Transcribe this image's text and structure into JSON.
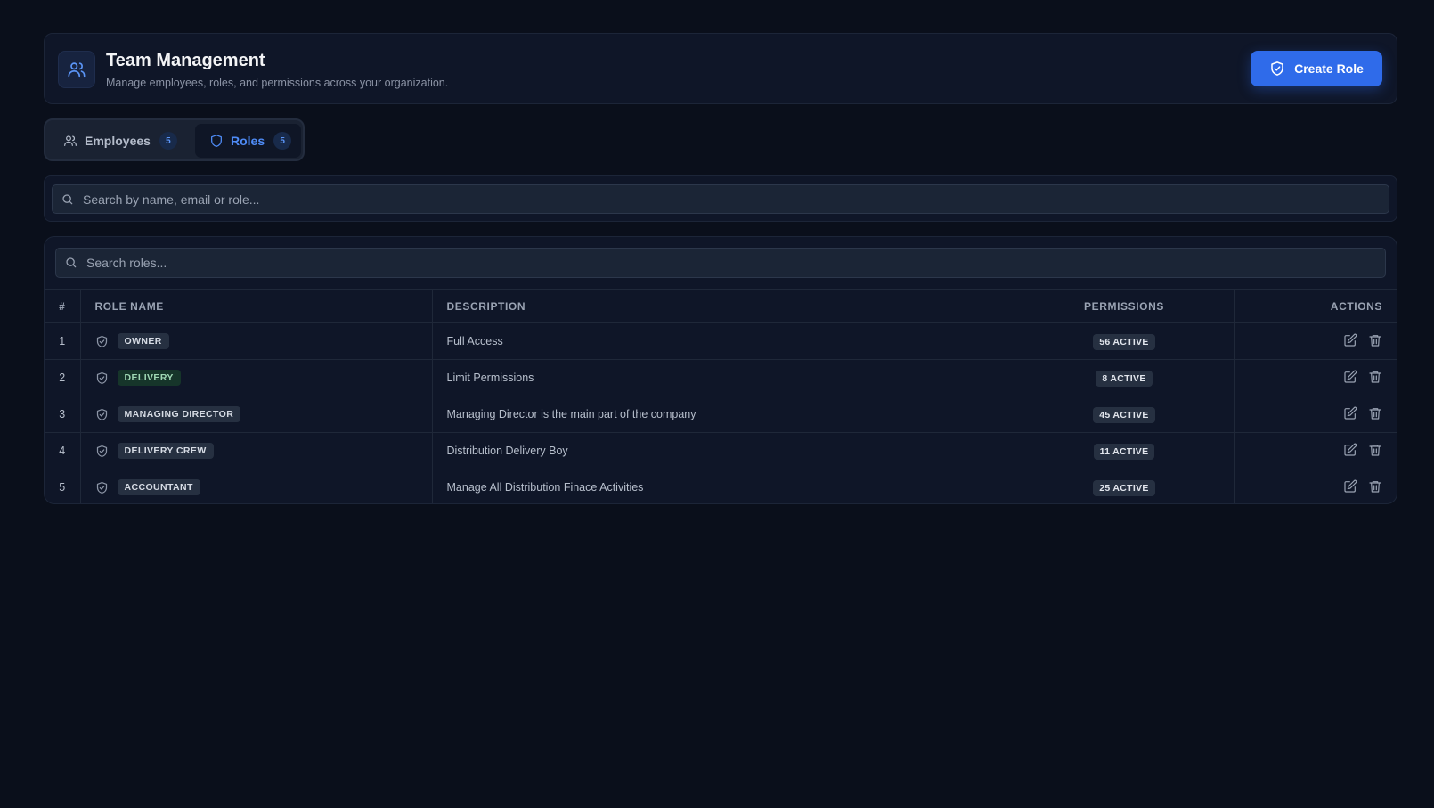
{
  "header": {
    "title": "Team Management",
    "subtitle": "Manage employees, roles, and permissions across your organization.",
    "create_button_label": "Create Role",
    "icon": "users-icon"
  },
  "tabs": [
    {
      "label": "Employees",
      "count": "5",
      "icon": "users-icon",
      "active": false
    },
    {
      "label": "Roles",
      "count": "5",
      "icon": "shield-icon",
      "active": true
    }
  ],
  "global_search": {
    "placeholder": "Search by name, email or role...",
    "value": ""
  },
  "roles_search": {
    "placeholder": "Search roles...",
    "value": ""
  },
  "table": {
    "columns": [
      "#",
      "ROLE NAME",
      "DESCRIPTION",
      "PERMISSIONS",
      "ACTIONS"
    ],
    "rows": [
      {
        "num": "1",
        "name": "OWNER",
        "description": "Full Access",
        "permissions": "56 ACTIVE",
        "chip_color": "#263041"
      },
      {
        "num": "2",
        "name": "DELIVERY",
        "description": "Limit Permissions",
        "permissions": "8 ACTIVE",
        "chip_color": "#16352a"
      },
      {
        "num": "3",
        "name": "MANAGING DIRECTOR",
        "description": "Managing Director is the main part of the company",
        "permissions": "45 ACTIVE",
        "chip_color": "#263041"
      },
      {
        "num": "4",
        "name": "DELIVERY CREW",
        "description": "Distribution Delivery Boy",
        "permissions": "11 ACTIVE",
        "chip_color": "#263041"
      },
      {
        "num": "5",
        "name": "ACCOUNTANT",
        "description": "Manage All Distribution Finace Activities",
        "permissions": "25 ACTIVE",
        "chip_color": "#263041"
      }
    ]
  },
  "colors": {
    "background": "#0a0f1b",
    "card": "#0f1628",
    "accent": "#2f6bea",
    "active_tab_text": "#4f8cf7"
  }
}
